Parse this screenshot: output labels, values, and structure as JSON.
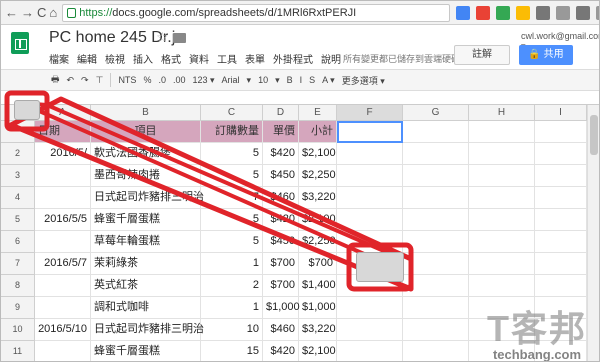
{
  "browser": {
    "url_https": "https://",
    "url_rest": "docs.google.com/spreadsheets/d/1MRl6RxtPERJI",
    "ext_colors": [
      "#4285f4",
      "#e94235",
      "#34a853",
      "#fbbc05",
      "#777777",
      "#999999",
      "#777777",
      "#999999",
      "#bbbbbb",
      "#1a8a3a"
    ]
  },
  "app": {
    "title": "PC home 245 Dr.j",
    "menus": [
      "檔案",
      "編輯",
      "檢視",
      "插入",
      "格式",
      "資料",
      "工具",
      "表單",
      "外掛程式",
      "說明"
    ],
    "save_status": "所有變更都已儲存到雲端硬碟",
    "account": "cwl.work@gmail.com ▾",
    "comment_label": "註解",
    "share_label": "共用"
  },
  "toolbar": {
    "items": [
      "NTS",
      "%",
      ".0",
      ".00",
      "123 ▾",
      "Arial",
      "▾",
      "10",
      "▾",
      "B",
      "I",
      "S",
      "A ▾",
      "更多選項 ▾"
    ]
  },
  "grid": {
    "col_headers": [
      "A",
      "B",
      "C",
      "D",
      "E",
      "F",
      "G",
      "H",
      "I"
    ],
    "header": [
      "日期",
      "項目",
      "訂購數量",
      "單價",
      "小計"
    ],
    "rows": [
      {
        "num": "2",
        "a": "2016/5/",
        "b": "軟式法國香腸堡",
        "c": "5",
        "d": "$420",
        "e": "$2,100"
      },
      {
        "num": "3",
        "a": "",
        "b": "墨西哥辣肉捲",
        "c": "5",
        "d": "$450",
        "e": "$2,250"
      },
      {
        "num": "4",
        "a": "",
        "b": "日式起司炸豬排三明治",
        "c": "7",
        "d": "$460",
        "e": "$3,220"
      },
      {
        "num": "5",
        "a": "2016/5/5",
        "b": "蜂蜜千層蛋糕",
        "c": "5",
        "d": "$420",
        "e": "$2,100"
      },
      {
        "num": "6",
        "a": "",
        "b": "草莓年輪蛋糕",
        "c": "5",
        "d": "$450",
        "e": "$2,250"
      },
      {
        "num": "7",
        "a": "2016/5/7",
        "b": "茉莉綠茶",
        "c": "1",
        "d": "$700",
        "e": "$700"
      },
      {
        "num": "8",
        "a": "",
        "b": "英式紅茶",
        "c": "2",
        "d": "$700",
        "e": "$1,400"
      },
      {
        "num": "9",
        "a": "",
        "b": "調和式咖啡",
        "c": "1",
        "d": "$1,000",
        "e": "$1,000"
      },
      {
        "num": "10",
        "a": "2016/5/10",
        "b": "日式起司炸豬排三明治",
        "c": "10",
        "d": "$460",
        "e": "$3,220"
      },
      {
        "num": "11",
        "a": "",
        "b": "蜂蜜千層蛋糕",
        "c": "15",
        "d": "$420",
        "e": "$2,100"
      }
    ]
  },
  "watermark": {
    "cjk": "T客邦",
    "en": "techbang.com"
  }
}
